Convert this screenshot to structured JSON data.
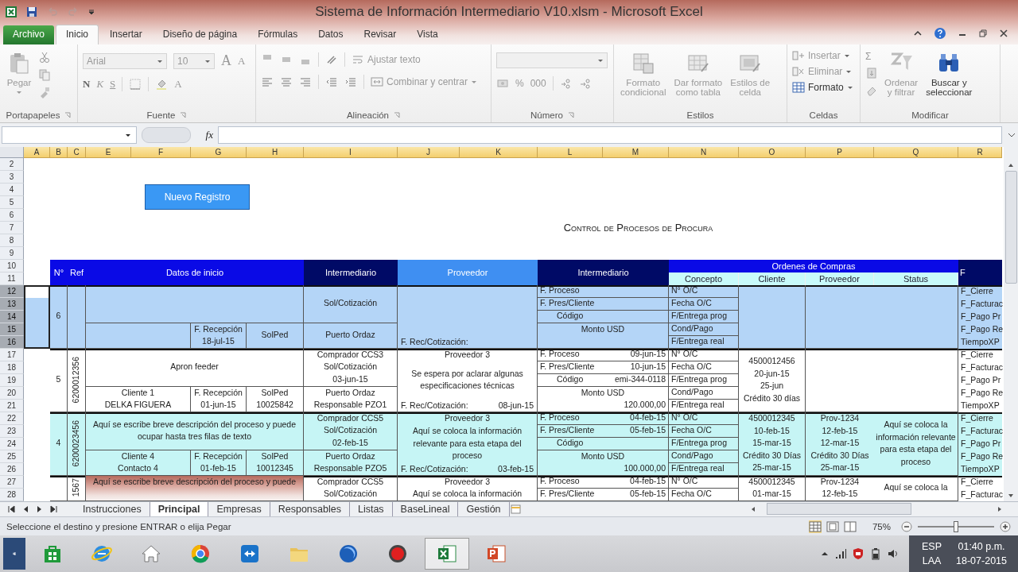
{
  "window": {
    "title": "Sistema de Información Intermediario V10.xlsm - Microsoft Excel"
  },
  "ribbon_tabs": [
    {
      "label": "Archivo",
      "kind": "file",
      "selected": false
    },
    {
      "label": "Inicio",
      "kind": "tab",
      "selected": true
    },
    {
      "label": "Insertar",
      "kind": "tab",
      "selected": false
    },
    {
      "label": "Diseño de página",
      "kind": "tab",
      "selected": false
    },
    {
      "label": "Fórmulas",
      "kind": "tab",
      "selected": false
    },
    {
      "label": "Datos",
      "kind": "tab",
      "selected": false
    },
    {
      "label": "Revisar",
      "kind": "tab",
      "selected": false
    },
    {
      "label": "Vista",
      "kind": "tab",
      "selected": false
    }
  ],
  "ribbon": {
    "clipboard": {
      "label": "Portapapeles",
      "paste": {
        "label": "Pegar",
        "disabled": true
      }
    },
    "font": {
      "label": "Fuente",
      "font_name": "Arial",
      "font_size": "10",
      "grow": "A",
      "shrink": "A",
      "bold": "N",
      "italic": "K",
      "underline": "S",
      "font_color": "A"
    },
    "alignment": {
      "label": "Alineación",
      "wrap_text": {
        "label": "Ajustar texto",
        "disabled": true
      },
      "merge": {
        "label": "Combinar y centrar",
        "disabled": true
      }
    },
    "number": {
      "label": "Número",
      "percent": "%",
      "thousands": "000"
    },
    "styles": {
      "label": "Estilos",
      "commands": [
        {
          "kind": "conditional",
          "lines": [
            "Formato",
            "condicional"
          ],
          "disabled": true
        },
        {
          "kind": "table",
          "lines": [
            "Dar formato",
            "como tabla"
          ],
          "disabled": true
        },
        {
          "kind": "cellstyle",
          "lines": [
            "Estilos de",
            "celda"
          ],
          "disabled": true
        }
      ]
    },
    "cells": {
      "label": "Celdas",
      "commands": [
        {
          "kind": "insert",
          "label": "Insertar",
          "disabled": true
        },
        {
          "kind": "delete",
          "label": "Eliminar",
          "disabled": true
        },
        {
          "kind": "format",
          "label": "Formato",
          "disabled": false
        }
      ]
    },
    "editing": {
      "label": "Modificar",
      "sum": "Σ",
      "commands": [
        {
          "kind": "sort",
          "lines": [
            "Ordenar",
            "y filtrar"
          ],
          "disabled": true
        },
        {
          "kind": "find",
          "lines": [
            "Buscar y",
            "seleccionar"
          ],
          "disabled": false
        }
      ]
    }
  },
  "formula_bar": {
    "function_label": "fx"
  },
  "sheet": {
    "columns": [
      "A",
      "B",
      "C",
      "E",
      "F",
      "G",
      "H",
      "I",
      "J",
      "K",
      "L",
      "M",
      "N",
      "O",
      "P",
      "Q",
      "R"
    ],
    "rows": [
      {
        "label": "2",
        "selected": false
      },
      {
        "label": "3",
        "selected": false
      },
      {
        "label": "4",
        "selected": false
      },
      {
        "label": "5",
        "selected": false
      },
      {
        "label": "6",
        "selected": false
      },
      {
        "label": "7",
        "selected": false
      },
      {
        "label": "8",
        "selected": false
      },
      {
        "label": "9",
        "selected": false
      },
      {
        "label": "10",
        "selected": false
      },
      {
        "label": "11",
        "selected": false
      },
      {
        "label": "12",
        "selected": true
      },
      {
        "label": "13",
        "selected": true
      },
      {
        "label": "14",
        "selected": true
      },
      {
        "label": "15",
        "selected": true
      },
      {
        "label": "16",
        "selected": true
      },
      {
        "label": "17",
        "selected": false
      },
      {
        "label": "18",
        "selected": false
      },
      {
        "label": "19",
        "selected": false
      },
      {
        "label": "20",
        "selected": false
      },
      {
        "label": "21",
        "selected": false
      },
      {
        "label": "22",
        "selected": false
      },
      {
        "label": "23",
        "selected": false
      },
      {
        "label": "24",
        "selected": false
      },
      {
        "label": "25",
        "selected": false
      },
      {
        "label": "26",
        "selected": false
      },
      {
        "label": "27",
        "selected": false
      },
      {
        "label": "28",
        "selected": false
      }
    ],
    "button": "Nuevo Registro",
    "title": "Control de Procesos de Procura",
    "header": {
      "number": "N°",
      "ref": "Ref",
      "start": "Datos de inicio",
      "intermediary": "Intermediario",
      "supplier": "Proveedor",
      "intermediary_2": "Intermediario",
      "orders": "Ordenes de Compras",
      "order_columns": [
        "Concepto",
        "Cliente",
        "Proveedor",
        "Status"
      ],
      "closing": "F"
    },
    "records": [
      {
        "color": "#b4d5f7",
        "number": "6",
        "int_top": [
          "Sol/Cotización"
        ],
        "int_bottom": [
          "Puerto Ordaz"
        ],
        "reception": [
          "F. Recepción",
          "18-jul-15"
        ],
        "solped": [
          "SolPed"
        ],
        "quote": {
          "label": "F. Rec/Cotización:"
        },
        "tracking": [
          {
            "kind": "date",
            "label": "F. Proceso"
          },
          {
            "kind": "date",
            "label": "F. Pres/Cliente"
          },
          {
            "kind": "code",
            "label": "Código"
          },
          {
            "kind": "amount",
            "label": "Monto USD"
          }
        ],
        "concepts": [
          "N° O/C",
          "Fecha O/C",
          "F/Entrega prog",
          "Cond/Pago",
          "F/Entrega real"
        ],
        "closing": [
          "F_Cierre",
          "F_Facturac",
          "F_Pago Pr",
          "F_Pago Re",
          "TiempoXP"
        ]
      },
      {
        "color": "#ffffff",
        "number": "5",
        "ref": "6200012356",
        "description": "Apron feeder",
        "client": [
          "Cliente 1",
          "DELKA FIGUERA"
        ],
        "reception": [
          "F. Recepción",
          "01-jun-15"
        ],
        "solped": [
          "SolPed",
          "10025842"
        ],
        "int_top": [
          "Comprador CCS3",
          "Sol/Cotización",
          "03-jun-15"
        ],
        "int_bottom": [
          "Puerto Ordaz",
          "Responsable PZO1"
        ],
        "supplier": {
          "name": "Proveedor 3",
          "note": "Se espera por aclarar algunas especificaciones técnicas"
        },
        "quote": {
          "label": "F. Rec/Cotización:",
          "date": "08-jun-15"
        },
        "tracking": [
          {
            "kind": "date",
            "label": "F. Proceso",
            "value": "09-jun-15"
          },
          {
            "kind": "date",
            "label": "F. Pres/Cliente",
            "value": "10-jun-15"
          },
          {
            "kind": "code",
            "label": "Código",
            "value": "emi-344-0118"
          },
          {
            "kind": "amount",
            "label": "Monto USD",
            "value": "120.000,00"
          }
        ],
        "concepts": [
          "N° O/C",
          "Fecha O/C",
          "F/Entrega prog",
          "Cond/Pago",
          "F/Entrega real"
        ],
        "order_client": [
          "4500012456",
          "20-jun-15",
          "25-jun",
          "Crédito 30 días"
        ],
        "closing": [
          "F_Cierre",
          "F_Facturac",
          "F_Pago Pr",
          "F_Pago Re",
          "TiempoXP"
        ]
      },
      {
        "color": "#c6f5f5",
        "number": "4",
        "ref": "6200023456",
        "description": "Aquí se escribe breve descripción del proceso y puede ocupar hasta tres filas de texto",
        "client": [
          "Cliente 4",
          "Contacto 4"
        ],
        "reception": [
          "F. Recepción",
          "01-feb-15"
        ],
        "solped": [
          "SolPed",
          "10012345"
        ],
        "int_top": [
          "Comprador CCS5",
          "Sol/Cotización",
          "02-feb-15"
        ],
        "int_bottom": [
          "Puerto Ordaz",
          "Responsable PZO5"
        ],
        "supplier": {
          "name": "Proveedor 3",
          "note": "Aquí se coloca la información relevante para esta etapa del proceso"
        },
        "quote": {
          "label": "F. Rec/Cotización:",
          "date": "03-feb-15"
        },
        "tracking": [
          {
            "kind": "date",
            "label": "F. Proceso",
            "value": "04-feb-15"
          },
          {
            "kind": "date",
            "label": "F. Pres/Cliente",
            "value": "05-feb-15"
          },
          {
            "kind": "code",
            "label": "Código"
          },
          {
            "kind": "amount",
            "label": "Monto USD",
            "value": "100.000,00"
          }
        ],
        "concepts": [
          "N° O/C",
          "Fecha O/C",
          "F/Entrega prog",
          "Cond/Pago",
          "F/Entrega real"
        ],
        "order_client": [
          "4500012345",
          "10-feb-15",
          "15-mar-15",
          "Crédito 30 Días",
          "25-mar-15"
        ],
        "order_supplier": [
          "Prov-1234",
          "12-feb-15",
          "12-mar-15",
          "Crédito 30 Días",
          "25-mar-15"
        ],
        "status": "Aquí se coloca la información relevante para esta etapa del proceso",
        "closing": [
          "F_Cierre",
          "F_Facturac",
          "F_Pago Pr",
          "F_Pago Re",
          "TiempoXP"
        ]
      },
      {
        "color": "#ffffff",
        "ref": "1567",
        "description": "Aquí se escribe breve descripción del proceso y puede",
        "int_top": [
          "Comprador CCS5",
          "Sol/Cotización"
        ],
        "supplier": {
          "name": "Proveedor 3",
          "note": "Aquí se coloca la información"
        },
        "tracking": [
          {
            "kind": "date",
            "label": "F. Proceso",
            "value": "04-feb-15"
          },
          {
            "kind": "date",
            "label": "F. Pres/Cliente",
            "value": "05-feb-15"
          }
        ],
        "concepts": [
          "N° O/C",
          "Fecha O/C"
        ],
        "order_client": [
          "4500012345",
          "01-mar-15"
        ],
        "order_supplier": [
          "Prov-1234",
          "12-feb-15"
        ],
        "status": "Aquí se coloca la",
        "closing": [
          "F_Cierre",
          "F_Facturac"
        ]
      }
    ]
  },
  "sheet_tabs": [
    {
      "label": "Instrucciones",
      "selected": false
    },
    {
      "label": "Principal",
      "selected": true
    },
    {
      "label": "Empresas",
      "selected": false
    },
    {
      "label": "Responsables",
      "selected": false
    },
    {
      "label": "Listas",
      "selected": false
    },
    {
      "label": "BaseLineal",
      "selected": false
    },
    {
      "label": "Gestión",
      "selected": false
    }
  ],
  "status_bar": {
    "message": "Seleccione el destino y presione ENTRAR o elija Pegar",
    "zoom": "75%",
    "zoom_slider": {
      "level": 0.5
    }
  },
  "taskbar": {
    "apps": [
      {
        "kind": "bag",
        "selected": false
      },
      {
        "kind": "globe",
        "selected": false
      },
      {
        "kind": "house",
        "selected": false
      },
      {
        "kind": "ball",
        "selected": false
      },
      {
        "kind": "arrows",
        "selected": false
      },
      {
        "kind": "folder",
        "selected": false
      },
      {
        "kind": "sphere",
        "selected": false
      },
      {
        "kind": "record",
        "selected": false
      },
      {
        "kind": "spreadsheet",
        "selected": true
      },
      {
        "kind": "slides",
        "selected": false
      }
    ],
    "tray": {
      "language": "ESP",
      "layout": "LAA",
      "time": "01:40 p.m.",
      "date": "18-07-2015"
    }
  }
}
